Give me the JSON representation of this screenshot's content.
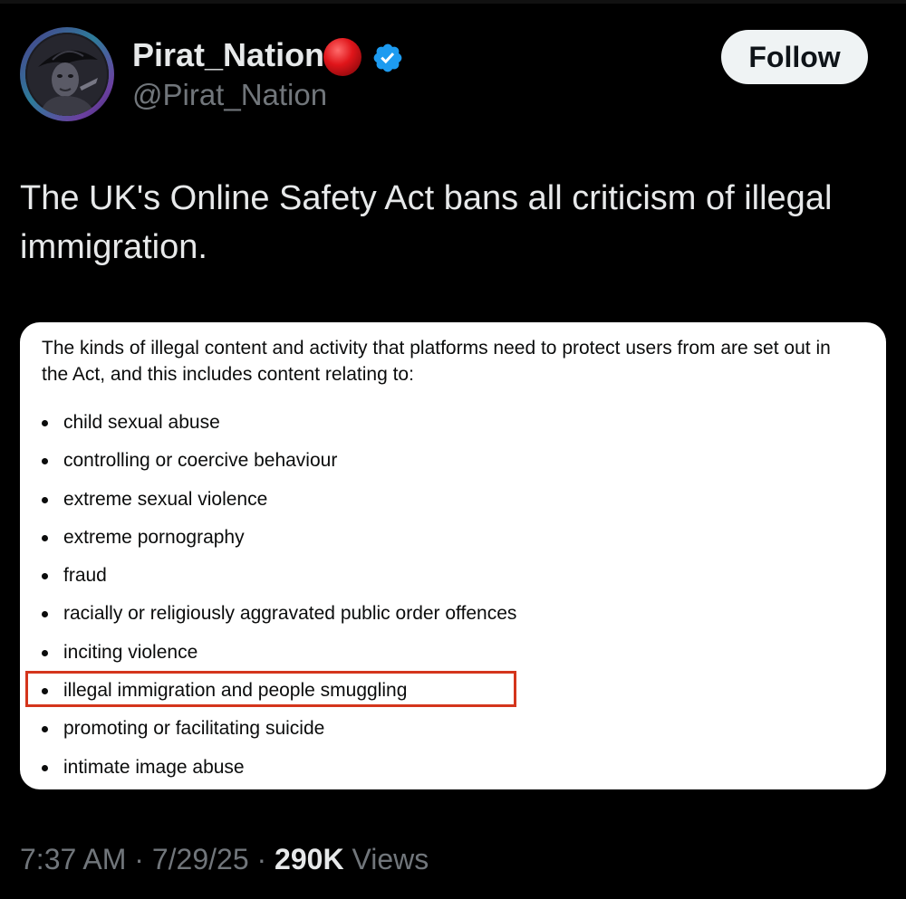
{
  "author": {
    "display_name": "Pirat_Nation",
    "handle": "@Pirat_Nation",
    "badge_color": "#e0151a",
    "verified_color": "#1d9bf0"
  },
  "follow_label": "Follow",
  "tweet": {
    "text": "The UK's Online Safety Act bans all criticism of illegal immigration."
  },
  "card": {
    "intro": "The kinds of illegal content and activity that platforms need to protect users from are set out in the Act, and this includes content relating to:",
    "items": [
      "child sexual abuse",
      "controlling or coercive behaviour",
      "extreme sexual violence",
      "extreme pornography",
      "fraud",
      "racially or religiously aggravated public order offences",
      "inciting violence",
      "illegal immigration and people smuggling",
      "promoting or facilitating suicide",
      "intimate image abuse"
    ],
    "highlighted_item": "illegal immigration and people smuggling",
    "highlight_color": "#d4351c"
  },
  "meta": {
    "time": "7:37 AM",
    "date": "7/29/25",
    "separator": "·",
    "views_count": "290K",
    "views_label": "Views"
  }
}
